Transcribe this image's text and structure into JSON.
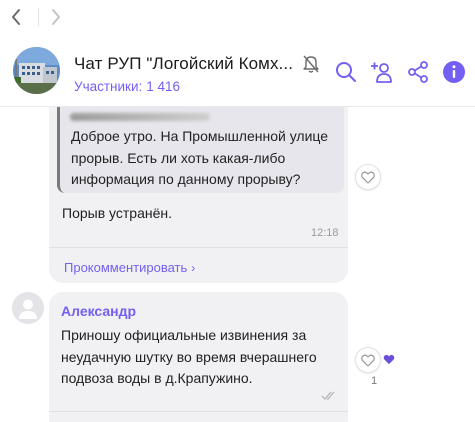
{
  "nav": {
    "back_icon": "chevron-left-icon",
    "forward_icon": "chevron-right-icon"
  },
  "header": {
    "title": "Чат РУП \"Логойский Комх...",
    "members_label": "Участники:",
    "members_count": "1 416",
    "mute_icon": "muted-bell-icon",
    "actions": [
      "search-icon",
      "add-member-icon",
      "share-icon",
      "info-icon"
    ],
    "accent_color": "#7360f2"
  },
  "messages": [
    {
      "quote_text": "Доброе утро. На Промышленной улице прорыв. Есть ли хоть какая-либо информация по данному прорыву?",
      "text": "Порыв устранён.",
      "time": "12:18",
      "comment_label": "Прокомментировать",
      "comment_chevron": "›"
    },
    {
      "sender": "Александр",
      "text": "Приношу официальные извинения за неудачную шутку во время вчерашнего подвоза воды в д.Крапужино.",
      "likes": "1"
    }
  ]
}
